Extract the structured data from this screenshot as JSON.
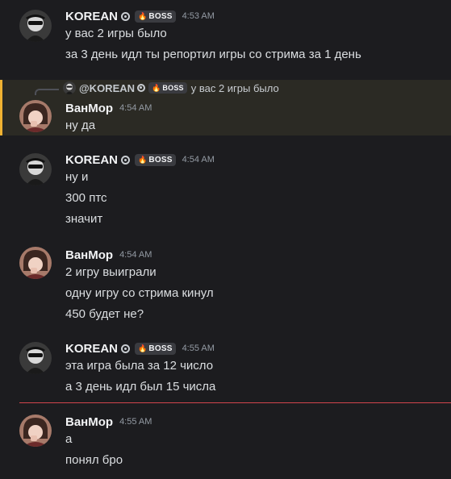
{
  "users": {
    "korean": {
      "name": "KOREAN",
      "tag": "BOSS"
    },
    "vanmor": {
      "name": "ВанМор"
    }
  },
  "reply": {
    "author": "@KOREAN",
    "tag": "BOSS",
    "text": "у вас 2 игры было"
  },
  "messages": [
    {
      "author": "KOREAN",
      "tag": "BOSS",
      "time": "4:53 AM",
      "lines": [
        "у вас 2 игры было",
        "за 3 день идл ты репортил игры со стрима за 1 день"
      ]
    },
    {
      "author": "ВанМор",
      "time": "4:54 AM",
      "lines": [
        "ну да"
      ]
    },
    {
      "author": "KOREAN",
      "tag": "BOSS",
      "time": "4:54 AM",
      "lines": [
        "ну и",
        "300 птс",
        "значит"
      ]
    },
    {
      "author": "ВанМор",
      "time": "4:54 AM",
      "lines": [
        "2 игру выиграли",
        "одну игру со стрима кинул",
        "450 будет не?"
      ]
    },
    {
      "author": "KOREAN",
      "tag": "BOSS",
      "time": "4:55 AM",
      "lines": [
        "эта игра была за 12 число",
        "а 3 день идл был 15 числа"
      ]
    },
    {
      "author": "ВанМор",
      "time": "4:55 AM",
      "lines": [
        "а",
        "понял бро"
      ]
    }
  ],
  "colors": {
    "background": "#1c1c1f",
    "mention_highlight": "#2b2a24",
    "mention_bar": "#f0b232",
    "new_messages_divider": "#d2454c"
  },
  "icons": {
    "verified": "gear-badge-icon",
    "boss_tag": "flame-icon"
  }
}
